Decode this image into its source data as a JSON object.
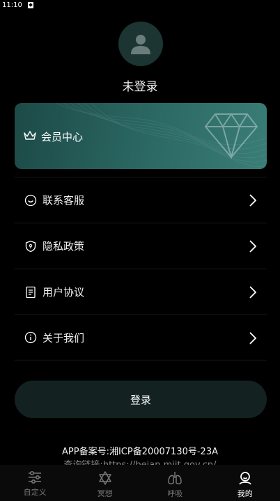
{
  "status_bar": {
    "time": "11:10"
  },
  "profile": {
    "username": "未登录"
  },
  "vip": {
    "label": "会员中心"
  },
  "menu": {
    "items": [
      {
        "label": "联系客服",
        "icon": "smile-icon"
      },
      {
        "label": "隐私政策",
        "icon": "shield-icon"
      },
      {
        "label": "用户协议",
        "icon": "document-icon"
      },
      {
        "label": "关于我们",
        "icon": "info-icon"
      }
    ]
  },
  "login": {
    "label": "登录"
  },
  "footer": {
    "icp": "APP备案号:湘ICP备20007130号-23A",
    "link": "查询链接:https://beian.miit.gov.cn/"
  },
  "tabbar": {
    "tabs": [
      {
        "label": "自定义",
        "icon": "sliders-icon",
        "active": false
      },
      {
        "label": "冥想",
        "icon": "star-of-david-icon",
        "active": false
      },
      {
        "label": "呼吸",
        "icon": "lungs-icon",
        "active": false
      },
      {
        "label": "我的",
        "icon": "user-icon",
        "active": true
      }
    ]
  },
  "colors": {
    "accent": "#2c6964",
    "background": "#000000",
    "button": "#132221"
  }
}
